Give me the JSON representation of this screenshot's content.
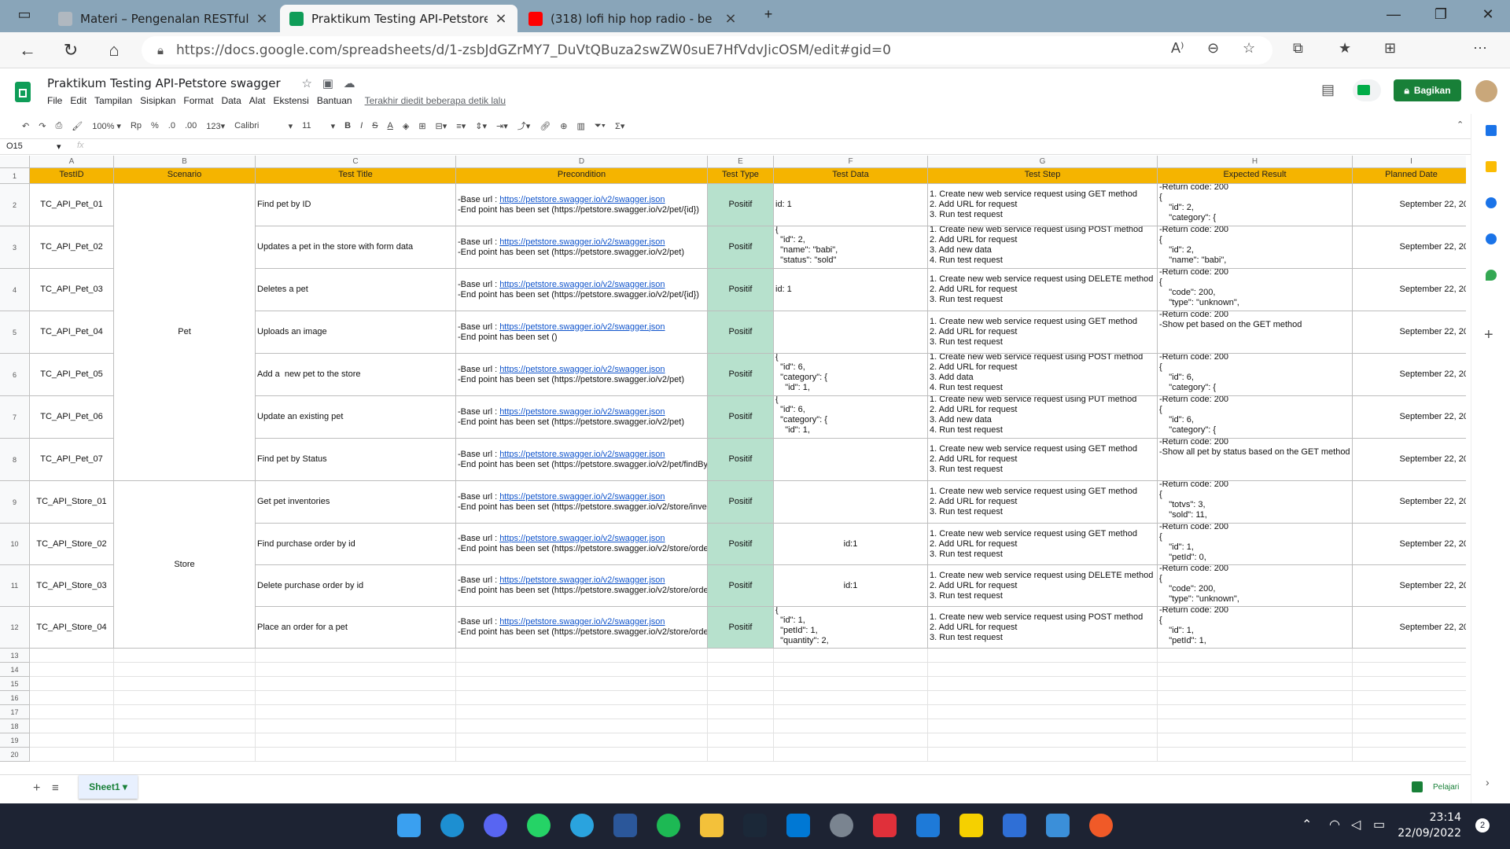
{
  "browser": {
    "tabs": [
      {
        "title": "Materi – Pengenalan RESTful API",
        "icon": "page-icon",
        "color": "#b0b8c0"
      },
      {
        "title": "Praktikum Testing API-Petstore s",
        "icon": "sheets-icon",
        "color": "#0f9d58"
      },
      {
        "title": "(318) lofi hip hop radio - be",
        "icon": "youtube-icon",
        "color": "#ff0000"
      }
    ],
    "url": "https://docs.google.com/spreadsheets/d/1-zsbJdGZrMY7_DuVtQBuza2swZW0suE7HfVdvJicOSM/edit#gid=0"
  },
  "doc": {
    "title": "Praktikum Testing API-Petstore swagger",
    "menus": [
      "File",
      "Edit",
      "Tampilan",
      "Sisipkan",
      "Format",
      "Data",
      "Alat",
      "Ekstensi",
      "Bantuan"
    ],
    "last_edit": "Terakhir diedit beberapa detik lalu",
    "share": "Bagikan"
  },
  "toolbar": {
    "zoom": "100%",
    "currency": "Rp",
    "percent": "%",
    "dec_less": ".0",
    "dec_more": ".00",
    "format": "123",
    "font": "Calibri",
    "size": "11"
  },
  "formula": {
    "cellref": "O15",
    "fx": "fx"
  },
  "sheet": {
    "col_letters": [
      "A",
      "B",
      "C",
      "D",
      "E",
      "F",
      "G",
      "H",
      "I"
    ],
    "headers": [
      "TestID",
      "Scenario",
      "Test Title",
      "Precondition",
      "Test Type",
      "Test Data",
      "Test Step",
      "Expected Result",
      "Planned Date"
    ],
    "scenarios": [
      "Pet",
      "Store"
    ],
    "row_numbers": [
      "1",
      "2",
      "3",
      "4",
      "5",
      "6",
      "7",
      "8",
      "9",
      "10",
      "11",
      "12",
      "13",
      "14",
      "15",
      "16",
      "17",
      "18",
      "19",
      "20"
    ],
    "base_label": "-Base url : ",
    "base_url": "https://petstore.swagger.io/v2/swagger.json",
    "rows": [
      {
        "id": "TC_API_Pet_01",
        "title": "Find pet by ID",
        "endpoint": "-End point has been set (https://petstore.swagger.io/v2/pet/{id})",
        "type": "Positif",
        "data": "id: 1",
        "step": "1. Create new web service request using GET method\n2. Add URL for request\n3. Run test request",
        "expected": "-Return code: 200\n{\n    \"id\": 2,\n    \"category\": {",
        "date": "September 22, 20"
      },
      {
        "id": "TC_API_Pet_02",
        "title": "Updates a pet in the store with form data",
        "endpoint": "-End point has been set (https://petstore.swagger.io/v2/pet)",
        "type": "Positif",
        "data": "{\n  \"id\": 2,\n  \"name\": \"babi\",\n  \"status\": \"sold\"",
        "step": "1. Create new web service request using POST method\n2. Add URL for request\n3. Add new data\n4. Run test request",
        "expected": "-Return code: 200\n{\n    \"id\": 2,\n    \"name\": \"babi\",",
        "date": "September 22, 20"
      },
      {
        "id": "TC_API_Pet_03",
        "title": "Deletes a pet",
        "endpoint": "-End point has been set (https://petstore.swagger.io/v2/pet/{id})",
        "type": "Positif",
        "data": "id: 1",
        "step": "1. Create new web service request using DELETE method\n2. Add URL for request\n3. Run test request",
        "expected": "-Return code: 200\n{\n    \"code\": 200,\n    \"type\": \"unknown\",",
        "date": "September 22, 20"
      },
      {
        "id": "TC_API_Pet_04",
        "title": "Uploads an image",
        "endpoint": "-End point has been set ()",
        "type": "Positif",
        "data": "",
        "step": "1. Create new web service request using GET method\n2. Add URL for request\n3. Run test request",
        "expected": "-Return code: 200\n-Show pet based on the GET method",
        "date": "September 22, 20"
      },
      {
        "id": "TC_API_Pet_05",
        "title": "Add a  new pet to the store",
        "endpoint": "-End point has been set (https://petstore.swagger.io/v2/pet)",
        "type": "Positif",
        "data": "{\n  \"id\": 6,\n  \"category\": {\n    \"id\": 1,",
        "step": "1. Create new web service request using POST method\n2. Add URL for request\n3. Add data\n4. Run test request",
        "expected": "-Return code: 200\n{\n    \"id\": 6,\n    \"category\": {",
        "date": "September 22, 20"
      },
      {
        "id": "TC_API_Pet_06",
        "title": "Update an existing pet",
        "endpoint": "-End point has been set (https://petstore.swagger.io/v2/pet)",
        "type": "Positif",
        "data": "{\n  \"id\": 6,\n  \"category\": {\n    \"id\": 1,",
        "step": "1. Create new web service request using PUT method\n2. Add URL for request\n3. Add new data\n4. Run test request",
        "expected": "-Return code: 200\n{\n    \"id\": 6,\n    \"category\": {",
        "date": "September 22, 20"
      },
      {
        "id": "TC_API_Pet_07",
        "title": "Find pet by Status",
        "endpoint": "-End point has been set (https://petstore.swagger.io/v2/pet/findBy",
        "type": "Positif",
        "data": "",
        "step": "1. Create new web service request using GET method\n2. Add URL for request\n3. Run test request",
        "expected": "-Return code: 200\n-Show all pet by status based on the GET method",
        "date": "September 22, 20"
      },
      {
        "id": "TC_API_Store_01",
        "title": "Get pet inventories",
        "endpoint": "-End point has been set (https://petstore.swagger.io/v2/store/inve",
        "type": "Positif",
        "data": "",
        "step": "1. Create new web service request using GET method\n2. Add URL for request\n3. Run test request",
        "expected": "-Return code: 200\n{\n    \"totvs\": 3,\n    \"sold\": 11,",
        "date": "September 22, 20"
      },
      {
        "id": "TC_API_Store_02",
        "title": "Find purchase order by id",
        "endpoint": "-End point has been set (https://petstore.swagger.io/v2/store/orde",
        "type": "Positif",
        "data": "id:1",
        "step": "1. Create new web service request using GET method\n2. Add URL for request\n3. Run test request",
        "expected": "-Return code: 200\n{\n    \"id\": 1,\n    \"petId\": 0,",
        "date": "September 22, 20"
      },
      {
        "id": "TC_API_Store_03",
        "title": "Delete purchase order by id",
        "endpoint": "-End point has been set (https://petstore.swagger.io/v2/store/orde",
        "type": "Positif",
        "data": "id:1",
        "step": "1. Create new web service request using DELETE method\n2. Add URL for request\n3. Run test request",
        "expected": "-Return code: 200\n{\n    \"code\": 200,\n    \"type\": \"unknown\",",
        "date": "September 22, 20"
      },
      {
        "id": "TC_API_Store_04",
        "title": "Place an order for a pet",
        "endpoint": "-End point has been set (https://petstore.swagger.io/v2/store/orde",
        "type": "Positif",
        "data": "{\n  \"id\": 1,\n  \"petId\": 1,\n  \"quantity\": 2,",
        "step": "1. Create new web service request using POST method\n2. Add URL for request\n3. Run test request",
        "expected": "-Return code: 200\n{\n    \"id\": 1,\n    \"petId\": 1,",
        "date": "September 22, 20"
      }
    ]
  },
  "sheettabs": {
    "add": "+",
    "list": "≡",
    "name": "Sheet1",
    "learn": "Pelajari"
  },
  "colors": {
    "header": "#f5b400",
    "type_fill": "#b7e1cd",
    "share": "#188038",
    "taskbar": "#1d2333"
  },
  "clock": {
    "time": "23:14",
    "date": "22/09/2022",
    "badge": "2"
  }
}
